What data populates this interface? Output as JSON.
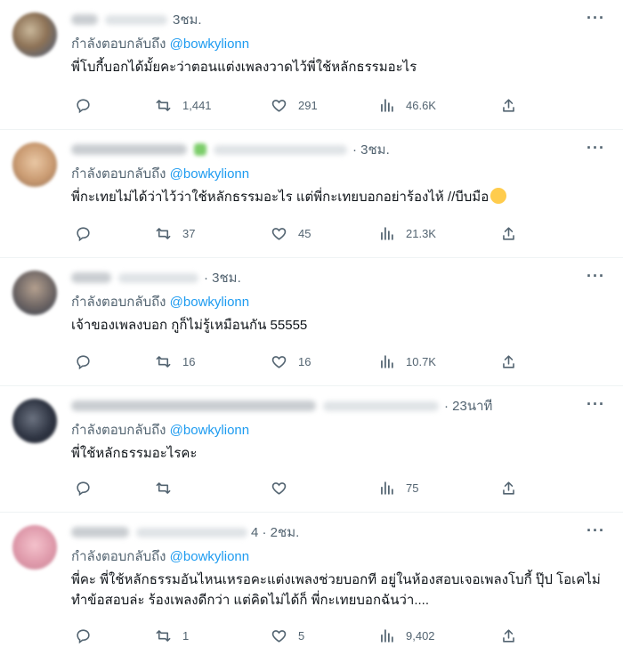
{
  "reply_prefix": "กำลังตอบกลับถึง",
  "tweets": [
    {
      "time": "3ชม.",
      "mention": "@bowkylionn",
      "text": "พี่โบกี้บอกได้มั้ยคะว่าตอนแต่งเพลงวาดไว้พี่ใช้หลักธรรมอะไร",
      "replies": "",
      "retweets": "1,441",
      "likes": "291",
      "views": "46.6K"
    },
    {
      "time": "· 3ชม.",
      "mention": "@bowkylionn",
      "text": "พี่กะเทยไม่ได้ว่าไว้ว่าใช้หลักธรรมอะไร แต่พี่กะเทยบอกอย่าร้องไห้ //บีบมือ",
      "replies": "",
      "retweets": "37",
      "likes": "45",
      "views": "21.3K"
    },
    {
      "time": "· 3ชม.",
      "mention": "@bowkylionn",
      "text": "เจ้าของเพลงบอก กูก็ไม่รู้เหมือนกัน 55555",
      "replies": "",
      "retweets": "16",
      "likes": "16",
      "views": "10.7K"
    },
    {
      "time": "· 23นาที",
      "mention": "@bowkylionn",
      "text": "พี่ใช้หลักธรรมอะไรคะ",
      "replies": "",
      "retweets": "",
      "likes": "",
      "views": "75"
    },
    {
      "time": "4 · 2ชม.",
      "mention": "@bowkylionn",
      "text": "พี่คะ พี่ใช้หลักธรรมอันไหนเหรอคะแต่งเพลงช่วยบอกที อยู่ในห้องสอบเจอเพลงโบกี้ ปุ๊ป โอเคไม่ทำข้อสอบล่ะ ร้องเพลงดีกว่า แต่คิดไม่ได้ก็ พี่กะเทยบอกฉันว่า....",
      "replies": "",
      "retweets": "1",
      "likes": "5",
      "views": "9,402"
    }
  ]
}
